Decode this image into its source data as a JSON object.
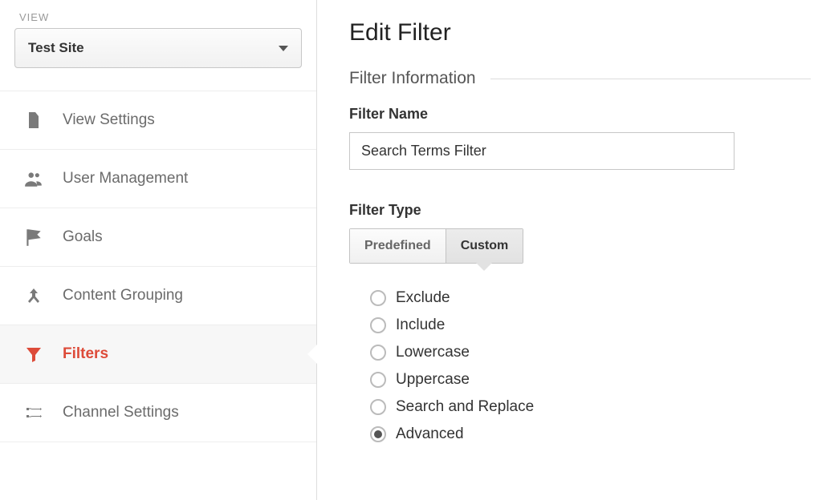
{
  "sidebar": {
    "view_label": "VIEW",
    "view_selected": "Test Site",
    "items": [
      {
        "label": "View Settings",
        "icon": "document-icon",
        "active": false
      },
      {
        "label": "User Management",
        "icon": "users-icon",
        "active": false
      },
      {
        "label": "Goals",
        "icon": "flag-icon",
        "active": false
      },
      {
        "label": "Content Grouping",
        "icon": "merge-icon",
        "active": false
      },
      {
        "label": "Filters",
        "icon": "funnel-icon",
        "active": true
      },
      {
        "label": "Channel Settings",
        "icon": "channels-icon",
        "active": false
      }
    ]
  },
  "main": {
    "title": "Edit Filter",
    "section_title": "Filter Information",
    "filter_name_label": "Filter Name",
    "filter_name_value": "Search Terms Filter",
    "filter_type_label": "Filter Type",
    "type_tabs": {
      "predefined": "Predefined",
      "custom": "Custom",
      "active": "custom"
    },
    "custom_options": [
      {
        "label": "Exclude",
        "checked": false
      },
      {
        "label": "Include",
        "checked": false
      },
      {
        "label": "Lowercase",
        "checked": false
      },
      {
        "label": "Uppercase",
        "checked": false
      },
      {
        "label": "Search and Replace",
        "checked": false
      },
      {
        "label": "Advanced",
        "checked": true
      }
    ]
  }
}
